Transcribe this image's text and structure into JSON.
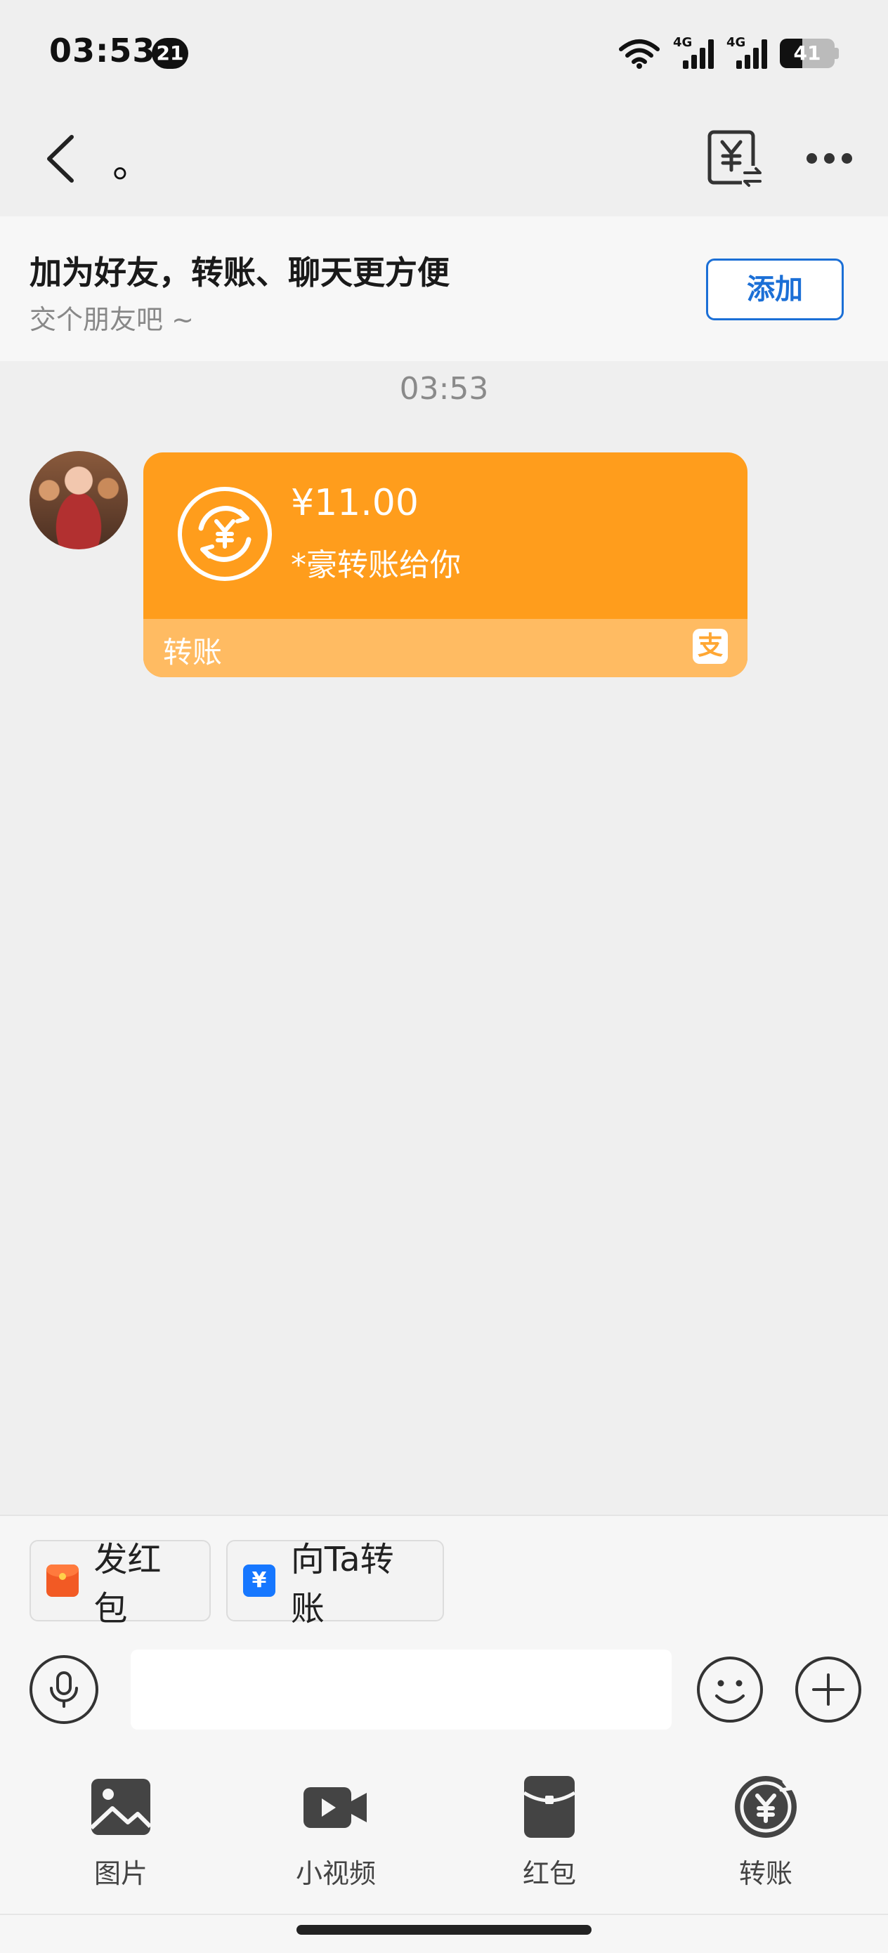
{
  "status_bar": {
    "time": "03:53",
    "notification_count": "21",
    "network_1": "4G",
    "network_2": "4G",
    "battery": "41"
  },
  "nav": {
    "title": "。",
    "back_icon": "chevron-left-icon",
    "bill_icon": "transfer-record-icon",
    "more_icon": "more-dots-icon"
  },
  "banner": {
    "title": "加为好友，转账、聊天更方便",
    "subtitle": "交个朋友吧 ~",
    "add_label": "添加"
  },
  "chat": {
    "timestamp": "03:53",
    "message": {
      "amount": "¥11.00",
      "description": "*豪转账给你",
      "footer_label": "转账",
      "brand_glyph": "支"
    }
  },
  "quick_actions": [
    {
      "label": "发红包",
      "icon": "red-packet-icon"
    },
    {
      "label": "向Ta转账",
      "icon": "transfer-icon"
    }
  ],
  "input": {
    "placeholder": "",
    "value": ""
  },
  "toolbar": [
    {
      "label": "图片",
      "icon": "image-icon"
    },
    {
      "label": "小视频",
      "icon": "video-icon"
    },
    {
      "label": "红包",
      "icon": "red-packet-icon"
    },
    {
      "label": "转账",
      "icon": "transfer-icon"
    }
  ],
  "colors": {
    "accent_blue": "#1b6fd6",
    "transfer_orange": "#ff9d1c",
    "transfer_footer": "#ffbb62"
  }
}
